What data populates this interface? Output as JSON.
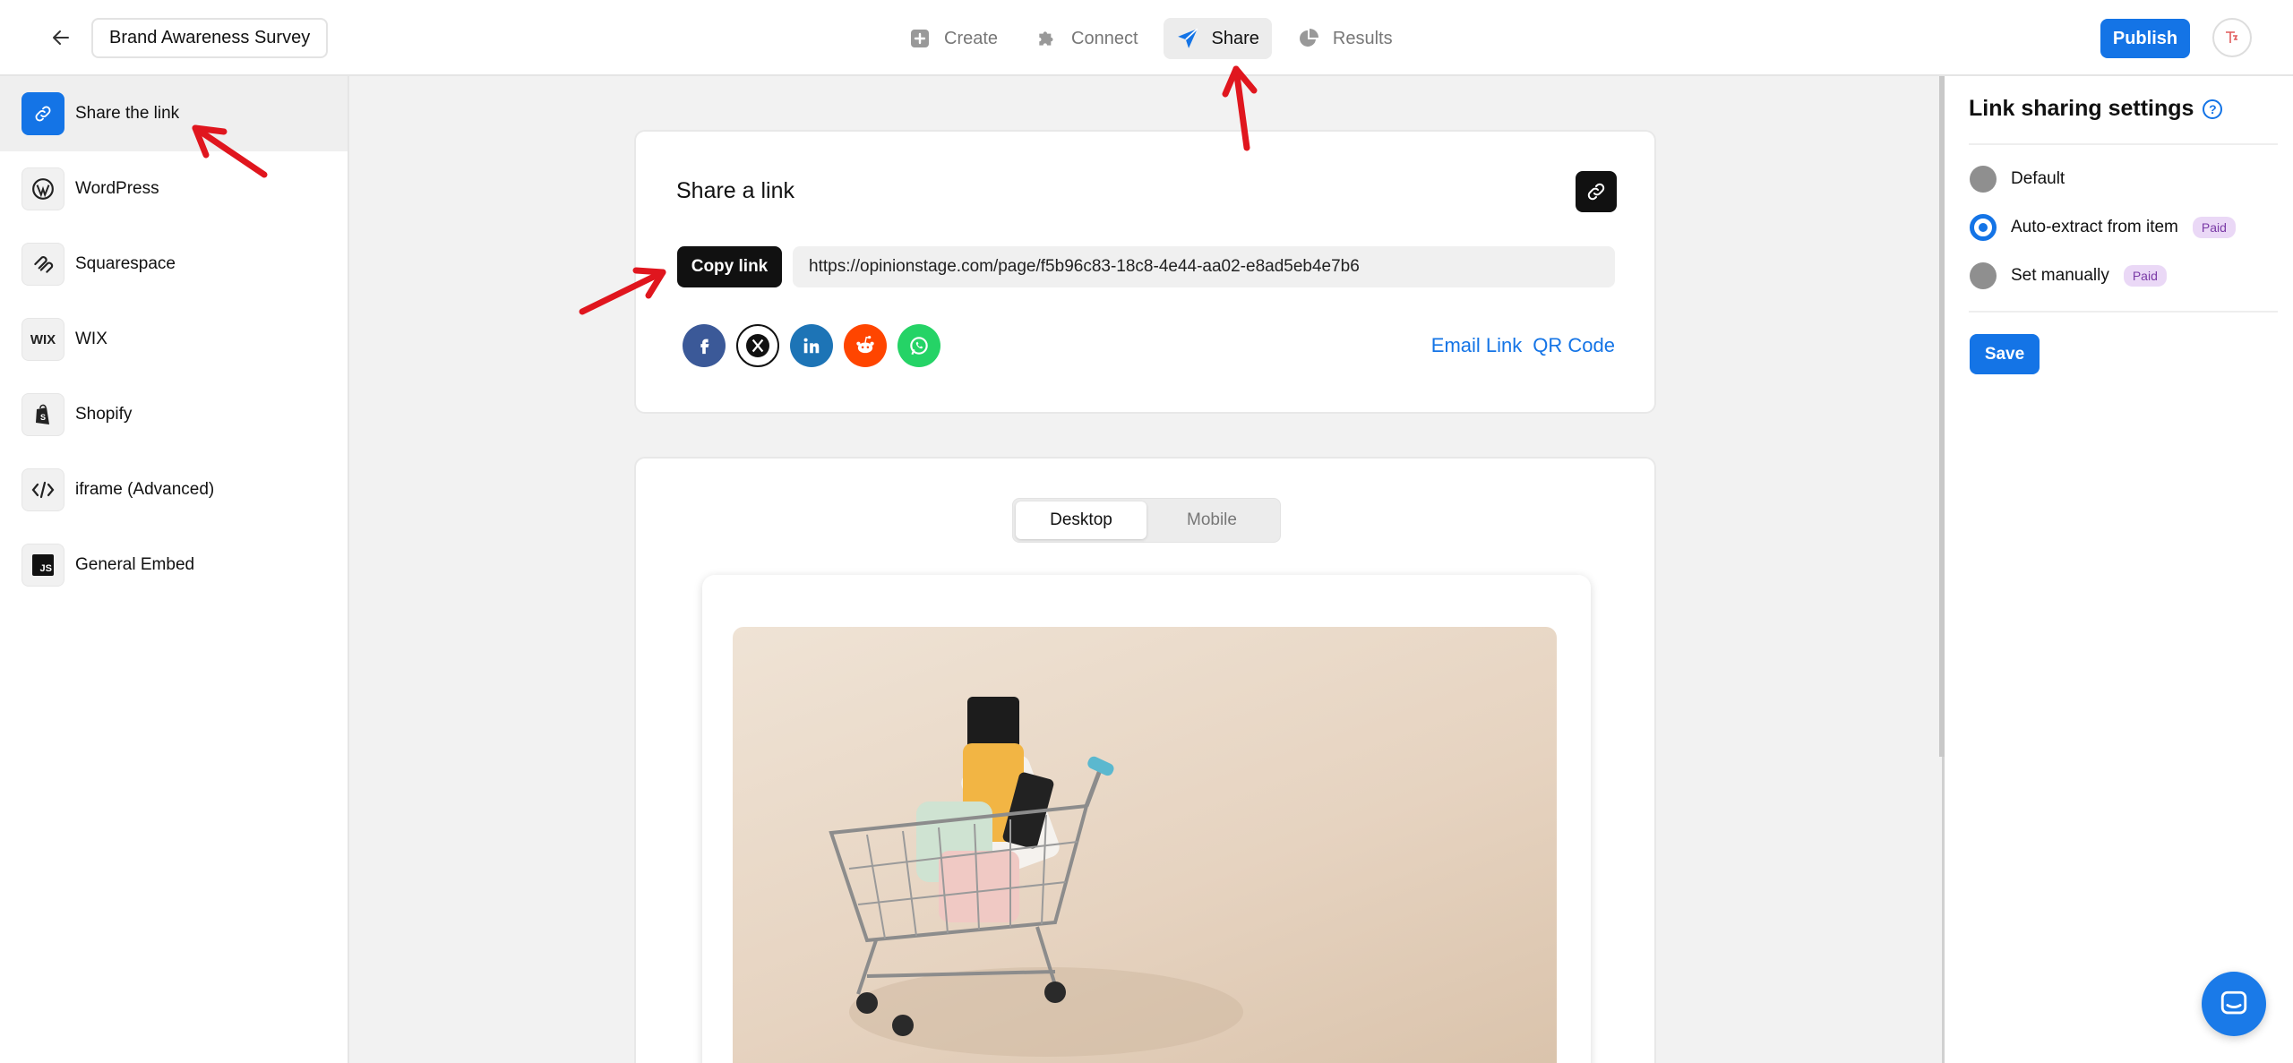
{
  "header": {
    "survey_title": "Brand Awareness Survey",
    "tabs": [
      {
        "label": "Create",
        "icon": "plus-square-icon"
      },
      {
        "label": "Connect",
        "icon": "puzzle-icon"
      },
      {
        "label": "Share",
        "icon": "paper-plane-icon",
        "active": true
      },
      {
        "label": "Results",
        "icon": "pie-chart-icon"
      }
    ],
    "publish_label": "Publish"
  },
  "sidebar": {
    "items": [
      {
        "label": "Share the link",
        "icon": "link-icon",
        "active": true
      },
      {
        "label": "WordPress",
        "icon": "wordpress-icon"
      },
      {
        "label": "Squarespace",
        "icon": "squarespace-icon"
      },
      {
        "label": "WIX",
        "icon": "wix-icon",
        "icon_text": "WIX"
      },
      {
        "label": "Shopify",
        "icon": "shopify-icon"
      },
      {
        "label": "iframe (Advanced)",
        "icon": "code-icon"
      },
      {
        "label": "General Embed",
        "icon": "js-icon",
        "icon_text": "JS"
      }
    ]
  },
  "share": {
    "title": "Share a link",
    "copy_label": "Copy link",
    "url": "https://opinionstage.com/page/f5b96c83-18c8-4e44-aa02-e8ad5eb4e7b6",
    "social": [
      "facebook",
      "x",
      "linkedin",
      "reddit",
      "whatsapp"
    ],
    "email_link_label": "Email Link",
    "qr_code_label": "QR Code"
  },
  "preview": {
    "options": [
      "Desktop",
      "Mobile"
    ],
    "selected": "Desktop"
  },
  "settings": {
    "title": "Link sharing settings",
    "help": "?",
    "options": [
      {
        "label": "Default",
        "checked": false
      },
      {
        "label": "Auto-extract from item",
        "checked": true,
        "badge": "Paid"
      },
      {
        "label": "Set manually",
        "checked": false,
        "badge": "Paid"
      }
    ],
    "save_label": "Save"
  },
  "colors": {
    "accent": "#1474e6",
    "annotation_arrow": "#e0161e",
    "paid_badge_bg": "#ead8f6"
  }
}
